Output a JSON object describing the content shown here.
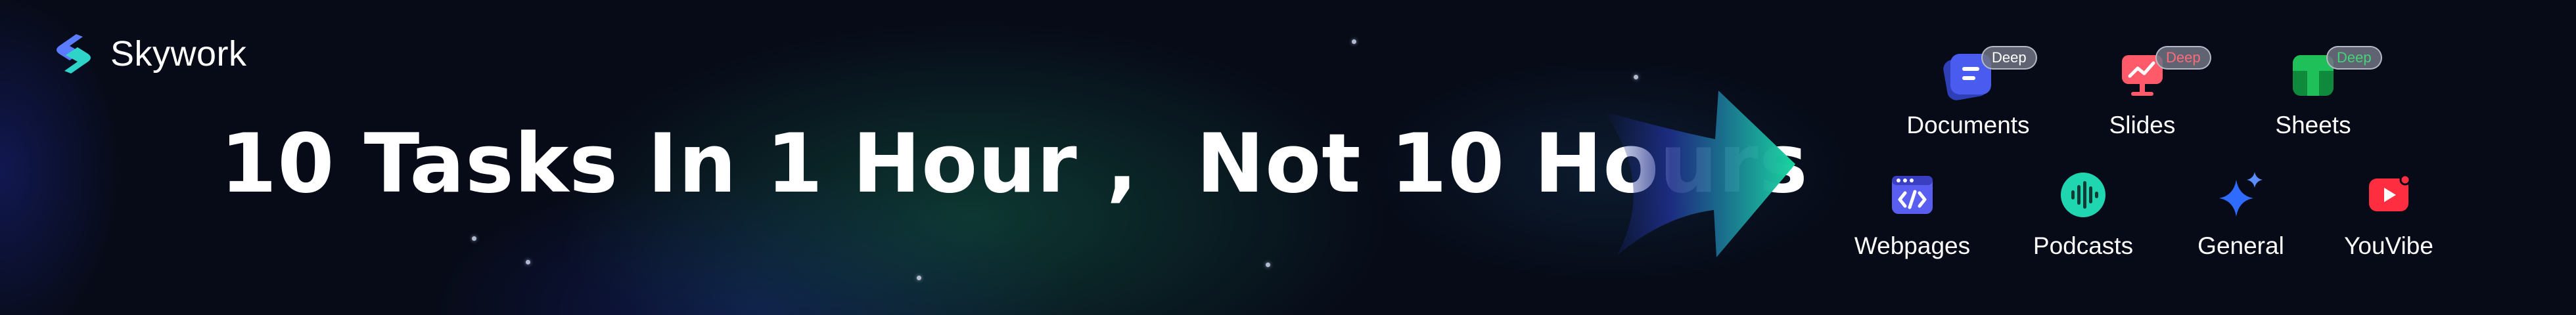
{
  "brand": {
    "name": "Skywork",
    "logo_icon": "skywork-logo-icon"
  },
  "headline": "10 Tasks In 1 Hour ,  Not 10 Hours",
  "colors": {
    "background": "#070b18",
    "arrow_start": "#1e2e8a",
    "arrow_end": "#19d6a0",
    "documents": "#4a5cf0",
    "slides": "#ff5a6a",
    "sheets": "#1fbf5a",
    "webpages": "#5a5ef0",
    "podcasts": "#1fd6b0",
    "general": "#2f6bff",
    "youvibe": "#ff2d40"
  },
  "apps": [
    {
      "label": "Documents",
      "icon": "documents-icon",
      "badge": "Deep"
    },
    {
      "label": "Slides",
      "icon": "slides-icon",
      "badge": "Deep"
    },
    {
      "label": "Sheets",
      "icon": "sheets-icon",
      "badge": "Deep"
    },
    {
      "label": "Webpages",
      "icon": "webpages-icon"
    },
    {
      "label": "Podcasts",
      "icon": "podcasts-icon"
    },
    {
      "label": "General",
      "icon": "general-sparkle-icon"
    },
    {
      "label": "YouVibe",
      "icon": "youvibe-play-icon"
    }
  ]
}
